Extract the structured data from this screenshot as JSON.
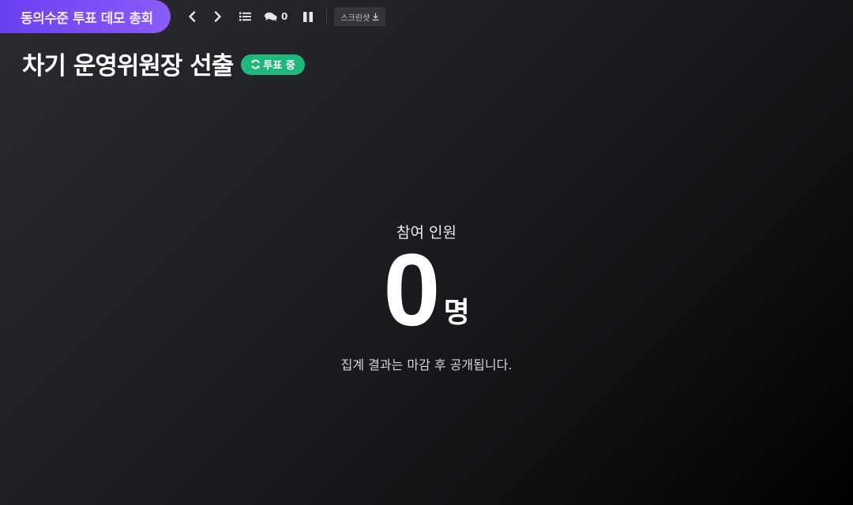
{
  "header": {
    "event_name": "동의수준 투표 데모 총회",
    "comment_count": "0",
    "screenshot_label": "스크린샷"
  },
  "title": {
    "text": "차기 운영위원장 선출",
    "status_badge": "투표 중"
  },
  "stats": {
    "label": "참여 인원",
    "count": "0",
    "unit": "명",
    "notice": "집계 결과는 마감 후 공개됩니다."
  },
  "colors": {
    "accent_purple": "#7b4ef6",
    "status_green": "#1fb87a",
    "background": "#1c1d21"
  },
  "icons": [
    "chevron-left-icon",
    "chevron-right-icon",
    "list-icon",
    "comments-icon",
    "pause-icon",
    "download-icon",
    "refresh-icon"
  ]
}
